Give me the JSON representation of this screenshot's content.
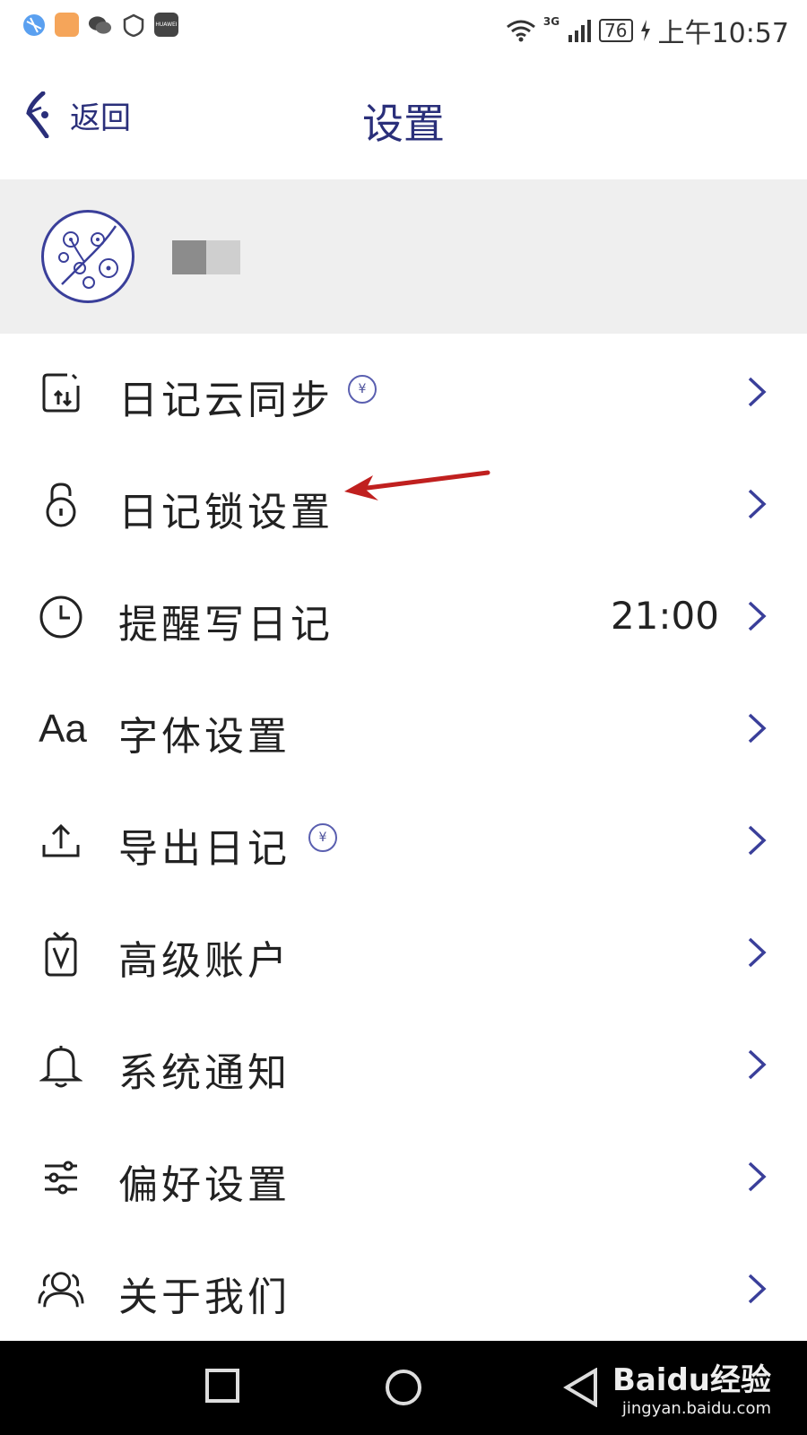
{
  "status_bar": {
    "time": "上午10:57",
    "battery": "76",
    "network": "3G",
    "app_icons": [
      "browser-icon",
      "notes-app-icon",
      "wechat-icon",
      "shield-app-icon",
      "huawei-store-icon"
    ],
    "huawei_label": "HUAWEI"
  },
  "header": {
    "back_label": "返回",
    "title": "设置"
  },
  "profile": {
    "avatar": "plum-blossom-avatar"
  },
  "menu": [
    {
      "id": "cloud-sync",
      "label": "日记云同步",
      "icon": "cloud-sync-icon",
      "vip": true,
      "value": ""
    },
    {
      "id": "diary-lock",
      "label": "日记锁设置",
      "icon": "lock-icon",
      "vip": false,
      "value": ""
    },
    {
      "id": "reminder",
      "label": "提醒写日记",
      "icon": "clock-icon",
      "vip": false,
      "value": "21:00"
    },
    {
      "id": "font",
      "label": "字体设置",
      "icon": "font-icon",
      "vip": false,
      "value": ""
    },
    {
      "id": "export",
      "label": "导出日记",
      "icon": "export-icon",
      "vip": true,
      "value": ""
    },
    {
      "id": "premium",
      "label": "高级账户",
      "icon": "vip-tag-icon",
      "vip": false,
      "value": ""
    },
    {
      "id": "notification",
      "label": "系统通知",
      "icon": "bell-icon",
      "vip": false,
      "value": ""
    },
    {
      "id": "preferences",
      "label": "偏好设置",
      "icon": "sliders-icon",
      "vip": false,
      "value": ""
    },
    {
      "id": "about",
      "label": "关于我们",
      "icon": "users-icon",
      "vip": false,
      "value": ""
    }
  ],
  "vip_symbol": "¥",
  "watermark": {
    "brand": "Baidu经验",
    "url": "jingyan.baidu.com"
  },
  "colors": {
    "accent": "#2a2f7a",
    "chevron": "#3a3f9a",
    "profile_bg": "#efefef",
    "annotation": "#c0201f"
  }
}
